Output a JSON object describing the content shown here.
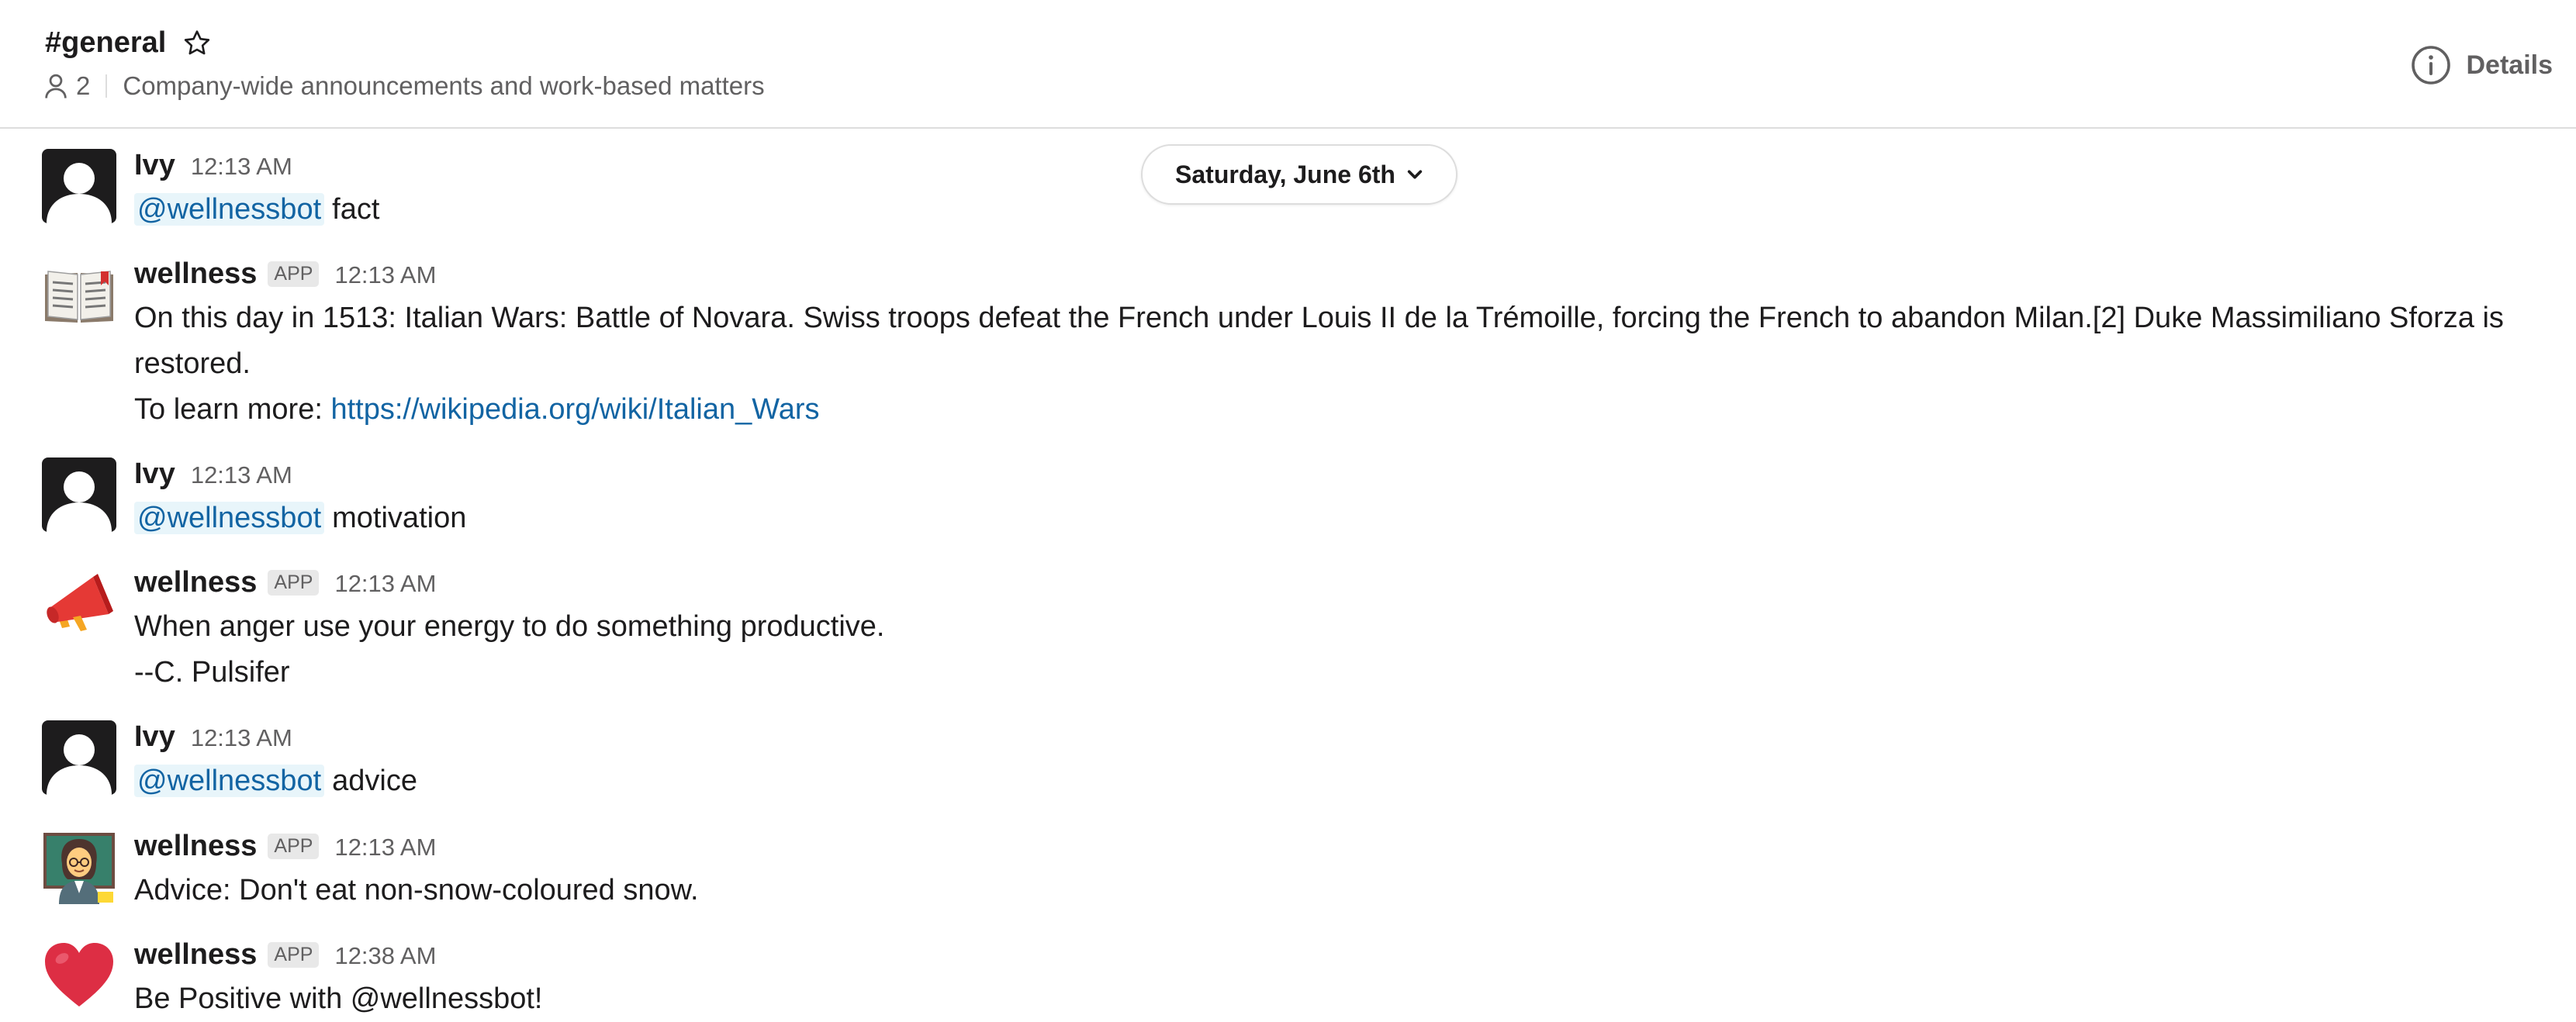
{
  "channel": {
    "name": "#general",
    "member_count": "2",
    "topic": "Company-wide announcements and work-based matters",
    "details_label": "Details"
  },
  "date_divider": "Saturday, June 6th",
  "messages": [
    {
      "author": "Ivy",
      "time": "12:13 AM",
      "mention": "@wellnessbot",
      "text": "fact"
    },
    {
      "author": "wellness",
      "badge": "APP",
      "time": "12:13 AM",
      "text": "On this day in 1513: Italian Wars: Battle of Novara. Swiss troops defeat the French under Louis II de la Trémoille, forcing the French to abandon Milan.[2] Duke Massimiliano Sforza is restored.",
      "learn_more_prefix": "To learn more:",
      "link": "https://wikipedia.org/wiki/Italian_Wars"
    },
    {
      "author": "Ivy",
      "time": "12:13 AM",
      "mention": "@wellnessbot",
      "text": "motivation"
    },
    {
      "author": "wellness",
      "badge": "APP",
      "time": "12:13 AM",
      "text": "When anger use your energy to do something productive.",
      "text2": "--C. Pulsifer"
    },
    {
      "author": "Ivy",
      "time": "12:13 AM",
      "mention": "@wellnessbot",
      "text": "advice"
    },
    {
      "author": "wellness",
      "badge": "APP",
      "time": "12:13 AM",
      "text": "Advice: Don't eat non-snow-coloured snow."
    },
    {
      "author": "wellness",
      "badge": "APP",
      "time": "12:38 AM",
      "text": "Be Positive with @wellnessbot!"
    }
  ],
  "icons": {
    "star": "star-icon",
    "members": "person-icon",
    "details": "info-icon",
    "chevron": "chevron-down-icon",
    "book": "open-book-icon",
    "megaphone": "megaphone-icon",
    "teacher": "teacher-icon",
    "heart": "heart-icon"
  },
  "colors": {
    "link": "#1264a3",
    "mention_bg": "#e8f5fa",
    "text": "#1d1c1d",
    "muted": "#616061"
  }
}
